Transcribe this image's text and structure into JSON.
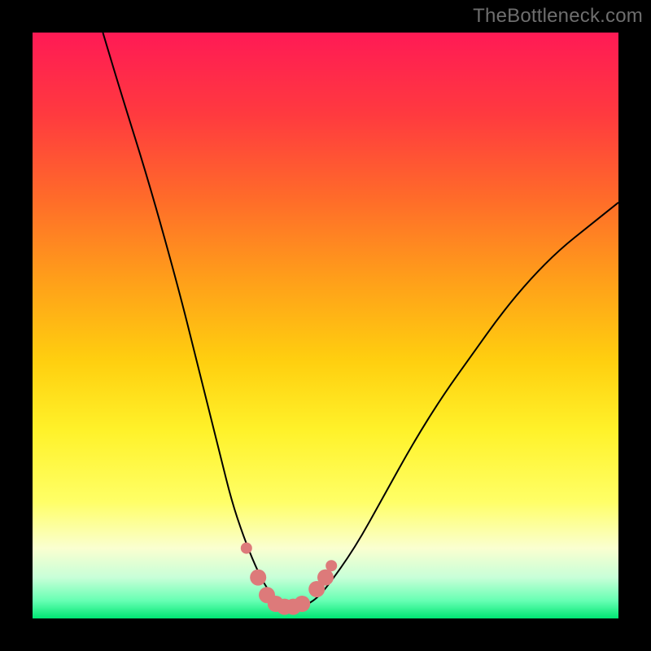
{
  "watermark": "TheBottleneck.com",
  "chart_data": {
    "type": "line",
    "title": "",
    "xlabel": "",
    "ylabel": "",
    "xlim": [
      0,
      100
    ],
    "ylim": [
      0,
      100
    ],
    "background_gradient": [
      "#ff1a4d",
      "#ff5a33",
      "#ff9d1a",
      "#ffd400",
      "#ffff33",
      "#f7ffcc",
      "#66ff99",
      "#00e673"
    ],
    "series": [
      {
        "name": "bottleneck-curve",
        "x": [
          12,
          15,
          20,
          25,
          28,
          30,
          32,
          34,
          36,
          38,
          40,
          42,
          44,
          46,
          48,
          50,
          55,
          60,
          65,
          70,
          75,
          80,
          85,
          90,
          95,
          100
        ],
        "y": [
          100,
          90,
          74,
          56,
          44,
          36,
          28,
          20,
          14,
          9,
          5,
          3,
          2,
          2,
          3,
          5,
          12,
          21,
          30,
          38,
          45,
          52,
          58,
          63,
          67,
          71
        ]
      }
    ],
    "markers": {
      "name": "highlight-dots",
      "color": "#dd7a7a",
      "points": [
        {
          "x": 36.5,
          "y": 12
        },
        {
          "x": 38.5,
          "y": 7
        },
        {
          "x": 40.0,
          "y": 4
        },
        {
          "x": 41.5,
          "y": 2.5
        },
        {
          "x": 43.0,
          "y": 2
        },
        {
          "x": 44.5,
          "y": 2
        },
        {
          "x": 46.0,
          "y": 2.5
        },
        {
          "x": 48.5,
          "y": 5
        },
        {
          "x": 50.0,
          "y": 7
        },
        {
          "x": 51.0,
          "y": 9
        }
      ]
    }
  }
}
